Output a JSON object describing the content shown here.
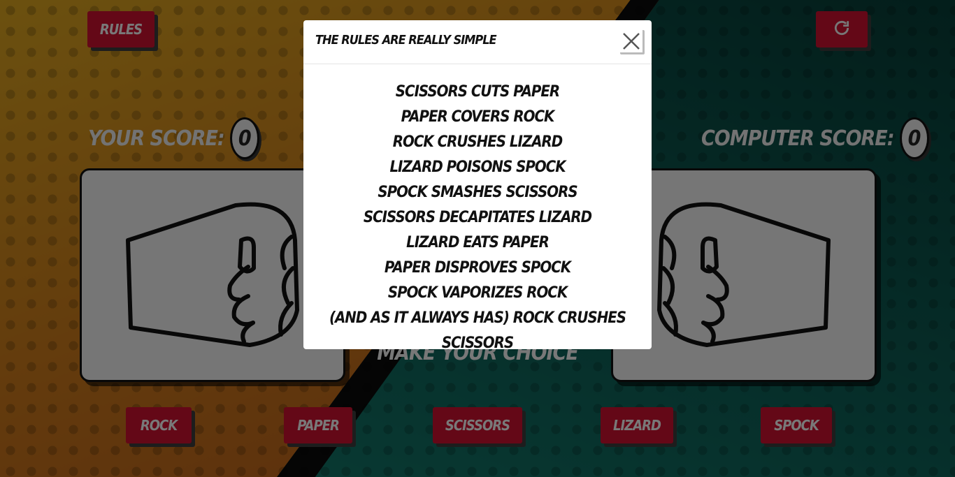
{
  "header": {
    "rules_label": "RULES",
    "reset_icon": "refresh-icon"
  },
  "scores": {
    "player_label": "YOUR SCORE:",
    "player_value": "0",
    "computer_label": "COMPUTER SCORE:",
    "computer_value": "0"
  },
  "hands": {
    "player_icon": "fist-icon",
    "computer_icon": "fist-icon"
  },
  "prompt": "MAKE YOUR CHOICE",
  "choices": [
    "ROCK",
    "PAPER",
    "SCISSORS",
    "LIZARD",
    "SPOCK"
  ],
  "modal": {
    "title": "THE RULES ARE REALLY SIMPLE",
    "close_icon": "close-icon",
    "rules": [
      "SCISSORS CUTS PAPER",
      "PAPER COVERS ROCK",
      "ROCK CRUSHES LIZARD",
      "LIZARD POISONS SPOCK",
      "SPOCK SMASHES SCISSORS",
      "SCISSORS DECAPITATES LIZARD",
      "LIZARD EATS PAPER",
      "PAPER DISPROVES SPOCK",
      "SPOCK VAPORIZES ROCK",
      "(AND AS IT ALWAYS HAS) ROCK CRUSHES SCISSORS"
    ]
  },
  "colors": {
    "button_red": "#c8102e",
    "left_bg": "#c8781a",
    "right_bg": "#0d5e55"
  }
}
